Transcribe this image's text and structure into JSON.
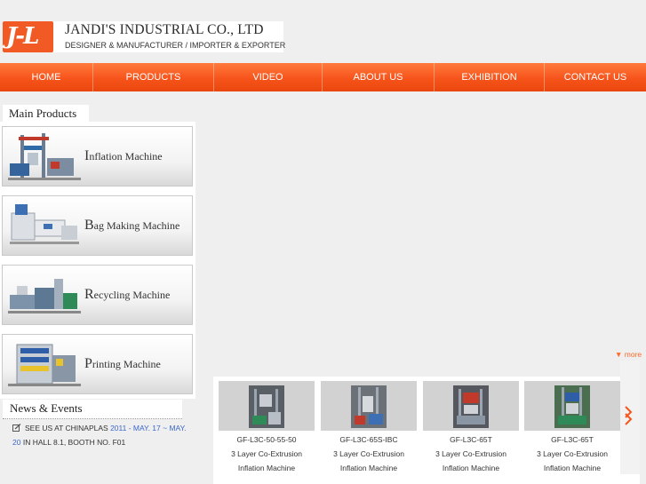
{
  "header": {
    "logo_text": "J-L",
    "company_name": "JANDI'S INDUSTRIAL CO., LTD",
    "tagline": "DESIGNER & MANUFACTURER / IMPORTER & EXPORTER"
  },
  "nav": {
    "items": [
      {
        "label": "HOME"
      },
      {
        "label": "PRODUCTS"
      },
      {
        "label": "VIDEO"
      },
      {
        "label": "ABOUT US"
      },
      {
        "label": "EXHIBITION"
      },
      {
        "label": "CONTACT US"
      }
    ]
  },
  "main_products": {
    "heading": "Main Products",
    "items": [
      {
        "label": "Inflation Machine"
      },
      {
        "label": "Bag Making Machine"
      },
      {
        "label": "Recycling Machine"
      },
      {
        "label": "Printing Machine"
      }
    ]
  },
  "news": {
    "heading": "News & Events",
    "item": {
      "part1": "SEE US AT CHINAPLAS ",
      "part2": "2011 - MAY. 17 ~ MAY. 20",
      "part3": " IN HALL 8.1, BOOTH NO. F01"
    }
  },
  "showcase": {
    "more_label": "more",
    "items": [
      {
        "code": "GF-L3C-50-55-50",
        "desc1": "3 Layer Co-Extrusion",
        "desc2": "Inflation Machine"
      },
      {
        "code": "GF-L3C-65S-IBC",
        "desc1": "3 Layer Co-Extrusion",
        "desc2": "Inflation Machine"
      },
      {
        "code": "GF-L3C-65T",
        "desc1": "3 Layer Co-Extrusion",
        "desc2": "Inflation Machine"
      },
      {
        "code": "GF-L3C-65T",
        "desc1": "3 Layer Co-Extrusion",
        "desc2": "Inflation Machine"
      }
    ]
  },
  "colors": {
    "accent": "#f7541c",
    "link": "#3b67c9",
    "background": "#efefef"
  }
}
